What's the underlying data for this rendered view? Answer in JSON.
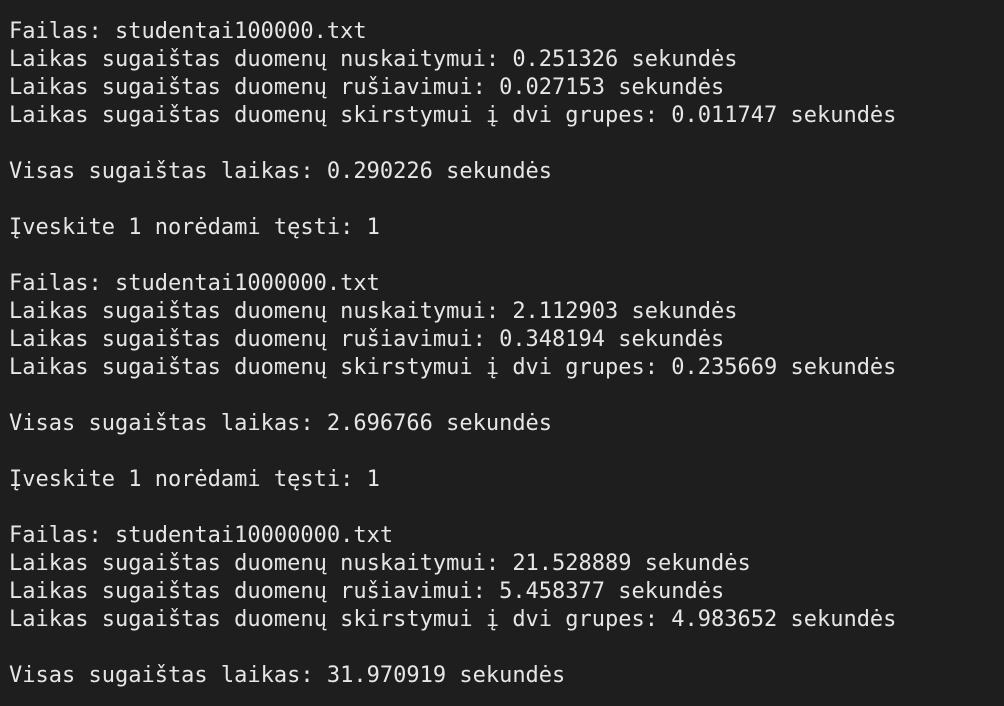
{
  "terminal": {
    "lines": [
      "Failas: studentai100000.txt",
      "Laikas sugaištas duomenų nuskaitymui: 0.251326 sekundės",
      "Laikas sugaištas duomenų rušiavimui: 0.027153 sekundės",
      "Laikas sugaištas duomenų skirstymui į dvi grupes: 0.011747 sekundės",
      "",
      "Visas sugaištas laikas: 0.290226 sekundės",
      "",
      "Įveskite 1 norėdami tęsti: 1",
      "",
      "Failas: studentai1000000.txt",
      "Laikas sugaištas duomenų nuskaitymui: 2.112903 sekundės",
      "Laikas sugaištas duomenų rušiavimui: 0.348194 sekundės",
      "Laikas sugaištas duomenų skirstymui į dvi grupes: 0.235669 sekundės",
      "",
      "Visas sugaištas laikas: 2.696766 sekundės",
      "",
      "Įveskite 1 norėdami tęsti: 1",
      "",
      "Failas: studentai10000000.txt",
      "Laikas sugaištas duomenų nuskaitymui: 21.528889 sekundės",
      "Laikas sugaištas duomenų rušiavimui: 5.458377 sekundės",
      "Laikas sugaištas duomenų skirstymui į dvi grupes: 4.983652 sekundės",
      "",
      "Visas sugaištas laikas: 31.970919 sekundės"
    ]
  }
}
